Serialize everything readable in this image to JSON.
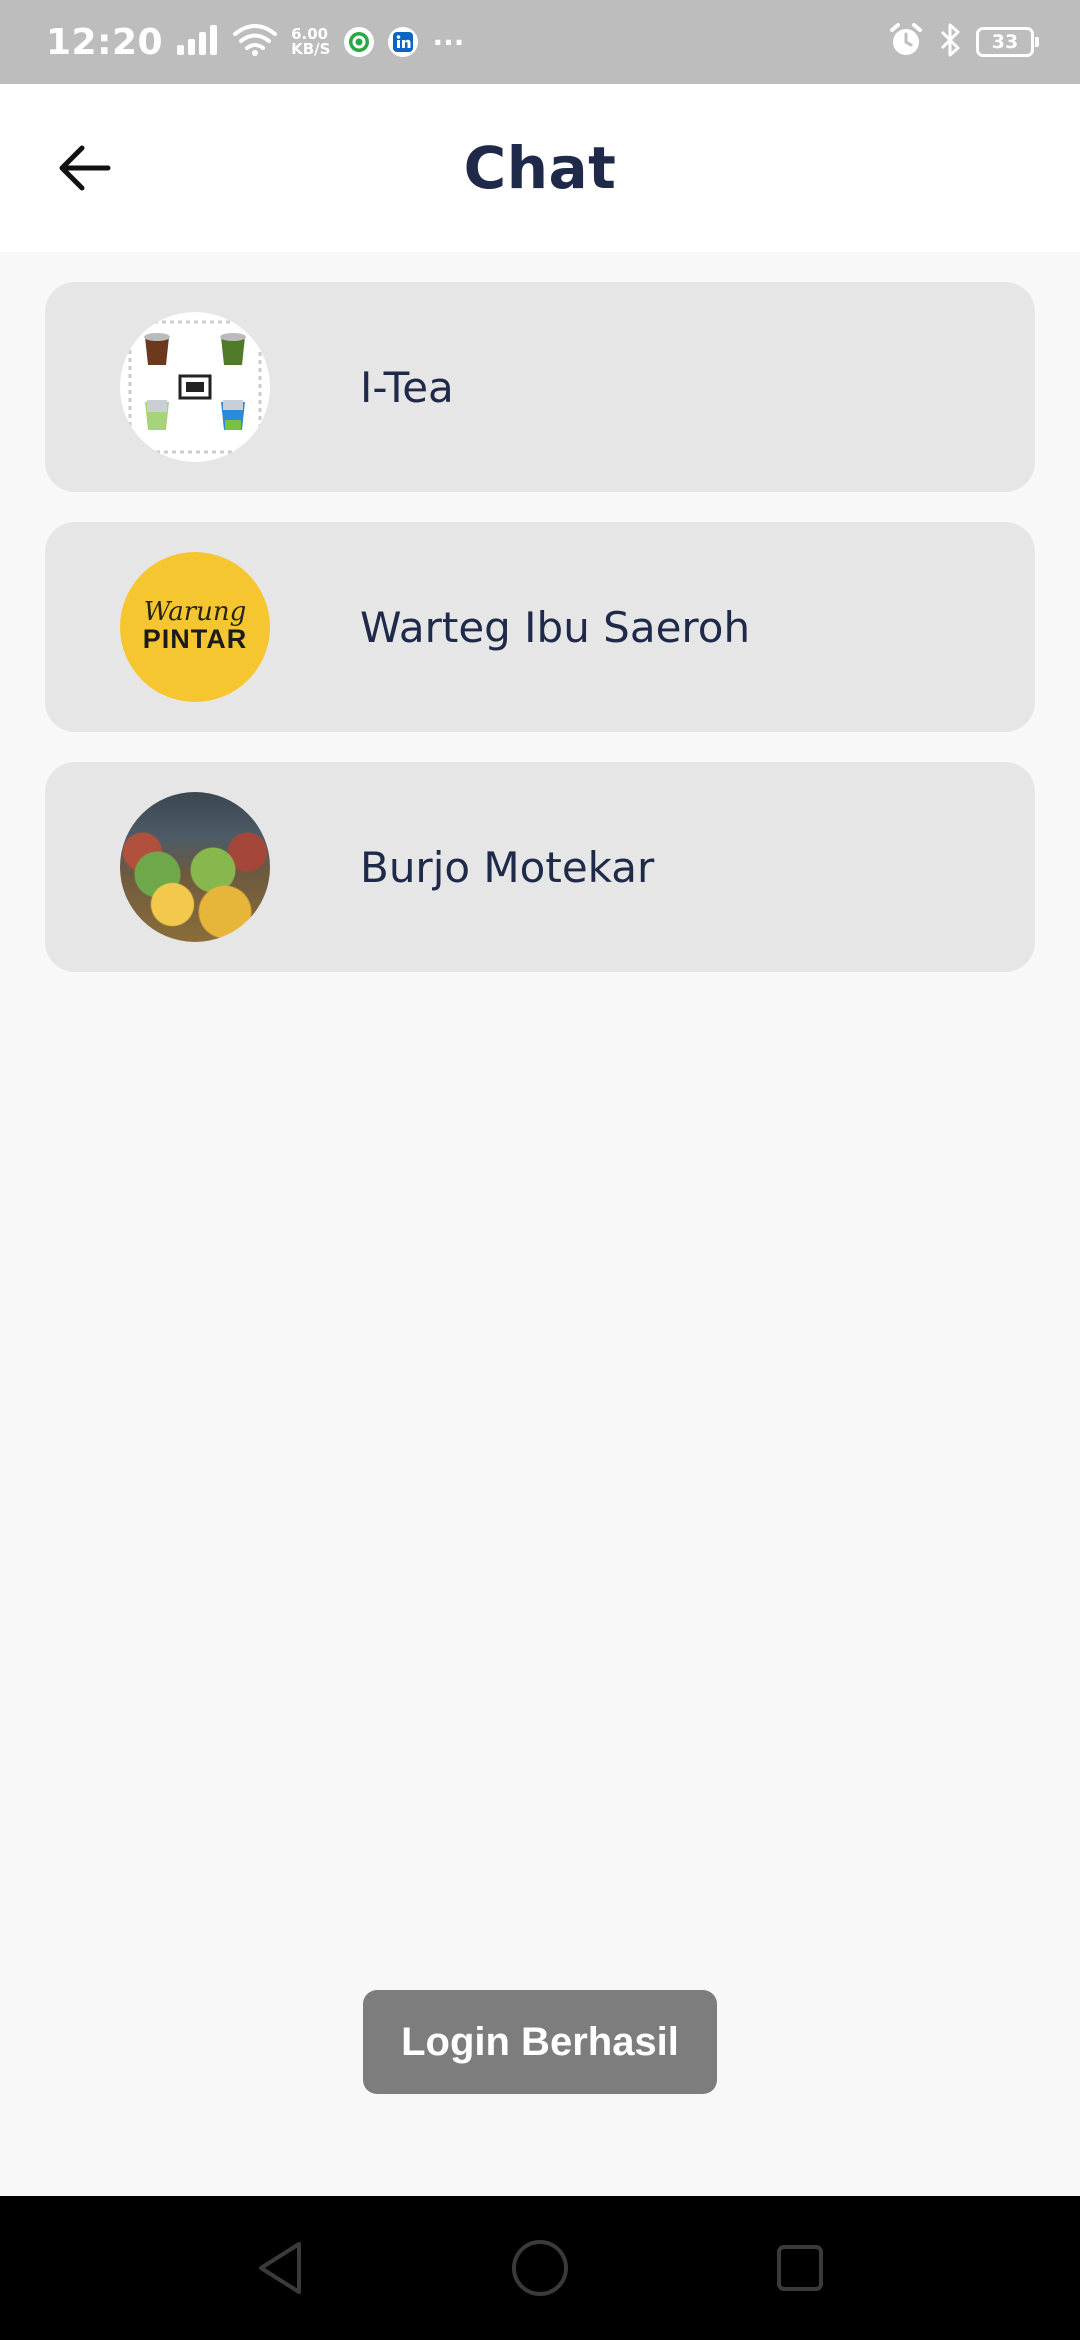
{
  "status_bar": {
    "time": "12:20",
    "net_speed_value": "6.00",
    "net_speed_unit": "KB/S",
    "overflow": "···",
    "battery": "33"
  },
  "header": {
    "title": "Chat"
  },
  "chats": [
    {
      "name": "I-Tea",
      "avatar": "drinks-logo"
    },
    {
      "name": "Warteg Ibu Saeroh",
      "avatar": "warung-pintar-logo",
      "avatar_script": "Warung",
      "avatar_bold": "PINTAR"
    },
    {
      "name": "Burjo Motekar",
      "avatar": "market-photo"
    }
  ],
  "toast": {
    "message": "Login Berhasil"
  },
  "colors": {
    "title": "#1f2a4a",
    "card": "#e6e6e6",
    "background": "#f8f8f8",
    "toast": "#7d7d7d",
    "warung_yellow": "#f6c630"
  }
}
